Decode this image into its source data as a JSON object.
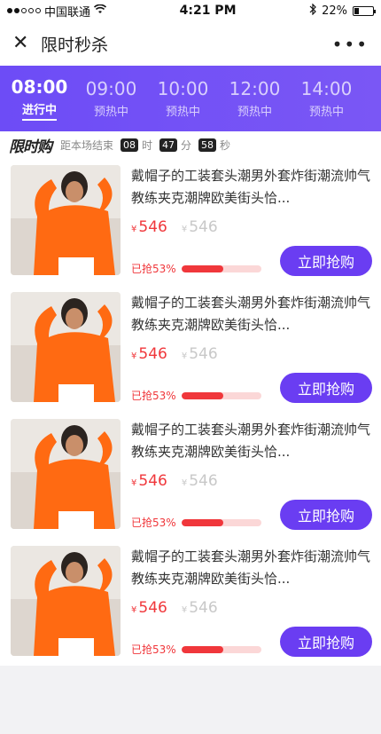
{
  "status_bar": {
    "carrier": "中国联通",
    "time": "4:21 PM",
    "battery": "22%"
  },
  "header": {
    "title": "限时秒杀",
    "close_icon": "close-icon",
    "more_icon": "more-icon"
  },
  "time_tabs": [
    {
      "time": "08:00",
      "status": "进行中",
      "active": true
    },
    {
      "time": "09:00",
      "status": "预热中",
      "active": false
    },
    {
      "time": "10:00",
      "status": "预热中",
      "active": false
    },
    {
      "time": "12:00",
      "status": "预热中",
      "active": false
    },
    {
      "time": "14:00",
      "status": "预热中",
      "active": false
    }
  ],
  "countdown": {
    "logo": "限时购",
    "label": "距本场结束",
    "hours": "08",
    "hours_unit": "时",
    "minutes": "47",
    "minutes_unit": "分",
    "seconds": "58",
    "seconds_unit": "秒"
  },
  "products": [
    {
      "name": "戴帽子的工装套头潮男外套炸街潮流帅气教练夹克潮牌欧美街头恰...",
      "currency": "¥",
      "price": "546",
      "original_price": "546",
      "sold_text": "已抢53%",
      "progress": 0.53,
      "button": "立即抢购"
    },
    {
      "name": "戴帽子的工装套头潮男外套炸街潮流帅气教练夹克潮牌欧美街头恰...",
      "currency": "¥",
      "price": "546",
      "original_price": "546",
      "sold_text": "已抢53%",
      "progress": 0.53,
      "button": "立即抢购"
    },
    {
      "name": "戴帽子的工装套头潮男外套炸街潮流帅气教练夹克潮牌欧美街头恰...",
      "currency": "¥",
      "price": "546",
      "original_price": "546",
      "sold_text": "已抢53%",
      "progress": 0.53,
      "button": "立即抢购"
    },
    {
      "name": "戴帽子的工装套头潮男外套炸街潮流帅气教练夹克潮牌欧美街头恰...",
      "currency": "¥",
      "price": "546",
      "original_price": "546",
      "sold_text": "已抢53%",
      "progress": 0.53,
      "button": "立即抢购"
    }
  ],
  "colors": {
    "accent": "#6a3df2",
    "price": "#f0373b",
    "tab_gradient_start": "#6d4cf6"
  }
}
